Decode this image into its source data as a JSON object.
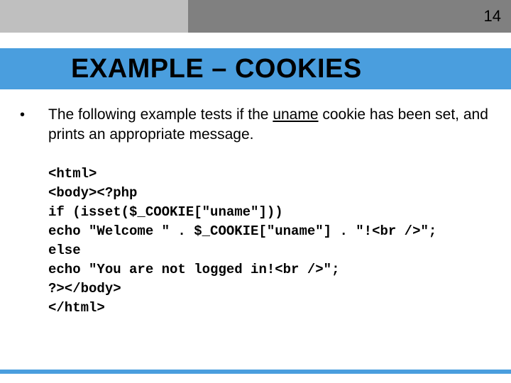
{
  "page_number": "14",
  "title": "EXAMPLE – COOKIES",
  "bullet": {
    "pre": "The following example tests if the ",
    "underlined": "uname",
    "post": " cookie has been set, and prints an appropriate message."
  },
  "code": {
    "l1": "<html>",
    "l2": "<body><?php",
    "l3": "if (isset($_COOKIE[\"uname\"]))",
    "l4": "echo \"Welcome \" . $_COOKIE[\"uname\"] . \"!<br />\";",
    "l5": "else",
    "l6": "echo \"You are not logged in!<br />\";",
    "l7": "?></body>",
    "l8": "</html>"
  }
}
